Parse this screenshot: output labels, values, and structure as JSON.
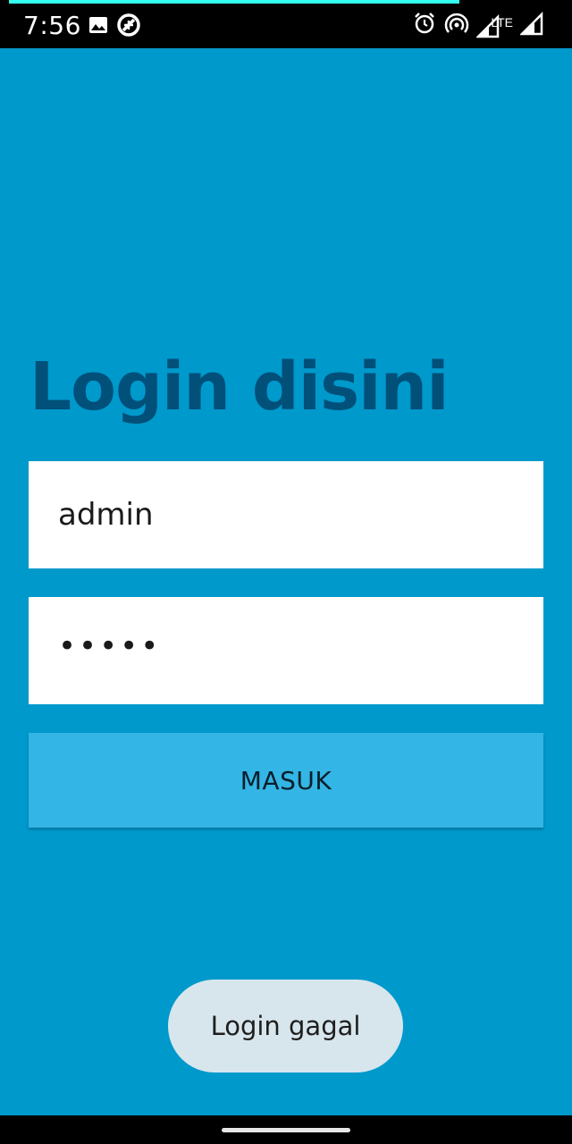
{
  "status_bar": {
    "time": "7:56",
    "network_label": "LTE",
    "progress_fraction": 0.8,
    "icons": [
      "image-icon",
      "data-saver-icon",
      "alarm-icon",
      "hotspot-icon",
      "signal-lte-icon",
      "signal-icon"
    ]
  },
  "login": {
    "title": "Login disini",
    "username_value": "admin",
    "password_masked": "•••••",
    "submit_label": "MASUK"
  },
  "toast": {
    "message": "Login gagal"
  },
  "colors": {
    "background": "#0099cc",
    "title": "#00507a",
    "button": "#33b5e5",
    "toast": "#d7e6ed",
    "progress": "#33ffee"
  }
}
